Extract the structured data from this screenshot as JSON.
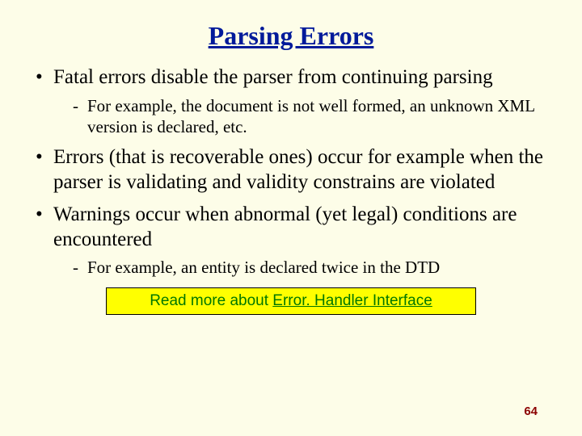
{
  "title": "Parsing Errors",
  "bullets": {
    "b1": "Fatal errors disable the parser from continuing parsing",
    "b1_sub1": "For example, the document is not well formed, an unknown XML version is declared, etc.",
    "b2": "Errors (that is recoverable ones) occur for example when the parser is validating and validity constrains are violated",
    "b3": "Warnings occur when abnormal (yet legal) conditions are encountered",
    "b3_sub1": "For example, an entity is declared twice in the DTD"
  },
  "linkbox": {
    "prefix": "Read more about ",
    "link": "Error. Handler Interface"
  },
  "page_number": "64"
}
